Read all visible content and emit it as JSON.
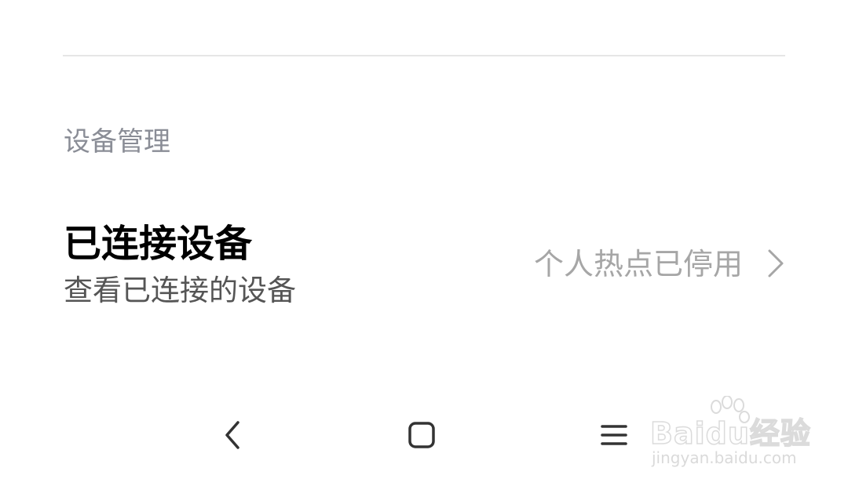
{
  "section": {
    "header": "设备管理"
  },
  "connected_devices": {
    "title": "已连接设备",
    "subtitle": "查看已连接的设备",
    "status": "个人热点已停用",
    "chevron_icon": "chevron-right-icon"
  },
  "nav_bar": {
    "back_icon": "chevron-left-icon",
    "home_icon": "rounded-square-icon",
    "menu_icon": "hamburger-icon"
  },
  "watermark": {
    "brand": "Baidu经验",
    "url": "jingyan.baidu.com"
  },
  "colors": {
    "background": "#ffffff",
    "divider": "#e6e6e6",
    "header_text": "#8a8d96",
    "title_text": "#000000",
    "subtitle_text": "#555555",
    "status_text": "#a6a6a6"
  }
}
